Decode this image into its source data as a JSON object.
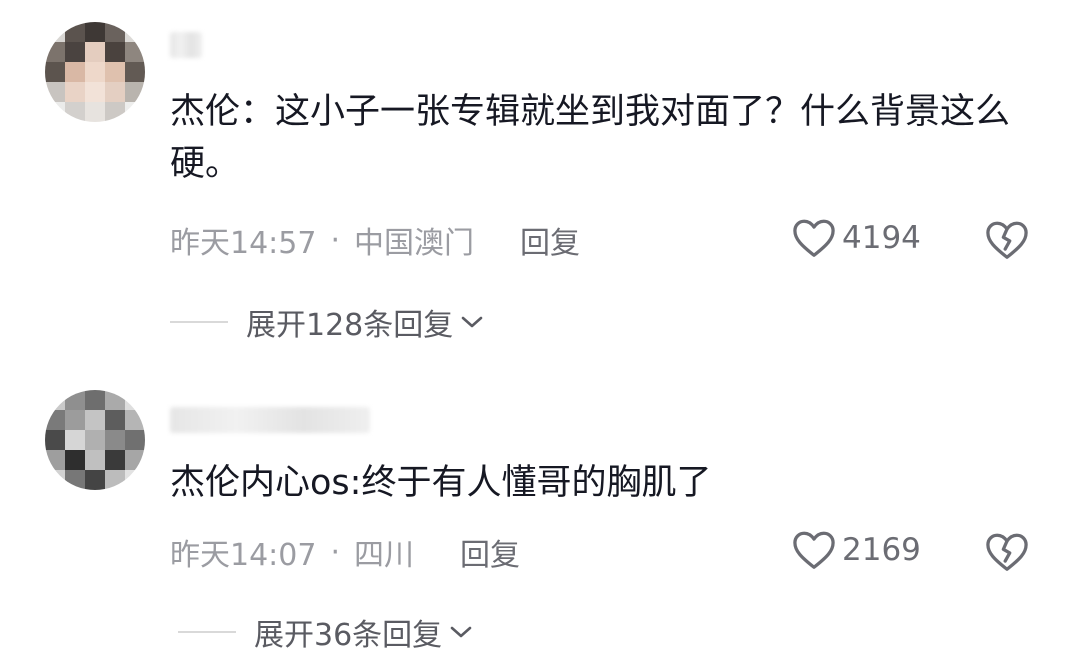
{
  "comments": [
    {
      "text": "杰伦：这小子一张专辑就坐到我对面了？什么背景这么硬。",
      "time": "昨天14:57",
      "separator": "·",
      "location": "中国澳门",
      "reply_label": "回复",
      "likes": "4194",
      "expand_label": "展开128条回复"
    },
    {
      "text": "杰伦内心os:终于有人懂哥的胸肌了",
      "time": "昨天14:07",
      "separator": "·",
      "location": "四川",
      "reply_label": "回复",
      "likes": "2169",
      "expand_label": "展开36条回复"
    }
  ],
  "icons": {
    "like": "heart-outline-icon",
    "dislike": "broken-heart-icon",
    "expand": "chevron-down-icon"
  },
  "colors": {
    "text": "#161823",
    "meta": "#9b9ca2",
    "action": "#6b6c73"
  }
}
